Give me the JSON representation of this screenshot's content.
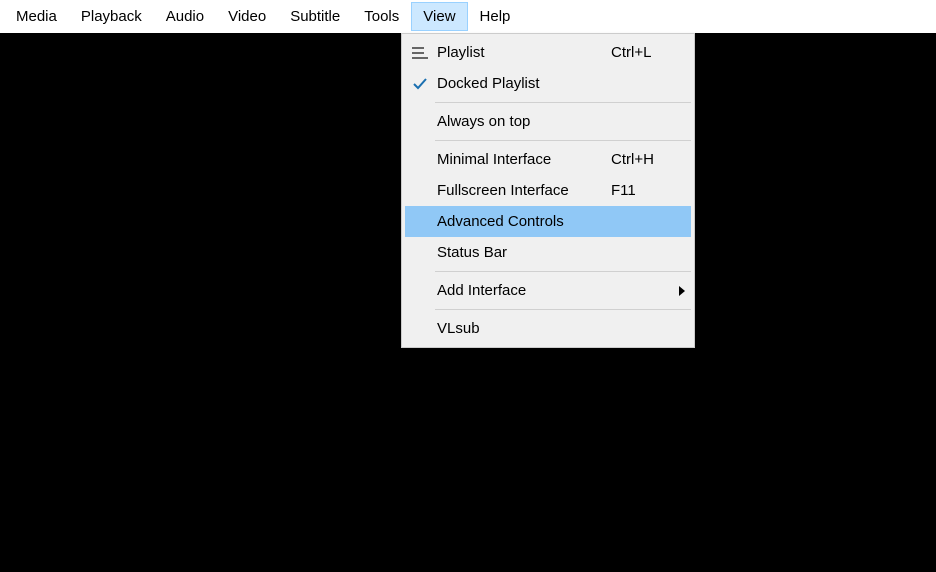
{
  "menubar": {
    "items": [
      {
        "label": "Media"
      },
      {
        "label": "Playback"
      },
      {
        "label": "Audio"
      },
      {
        "label": "Video"
      },
      {
        "label": "Subtitle"
      },
      {
        "label": "Tools"
      },
      {
        "label": "View"
      },
      {
        "label": "Help"
      }
    ],
    "active_index": 6
  },
  "dropdown": {
    "items": [
      {
        "label": "Playlist",
        "shortcut": "Ctrl+L",
        "icon": "playlist"
      },
      {
        "label": "Docked Playlist",
        "shortcut": "",
        "icon": "check"
      },
      {
        "separator": true
      },
      {
        "label": "Always on top",
        "shortcut": "",
        "icon": ""
      },
      {
        "separator": true
      },
      {
        "label": "Minimal Interface",
        "shortcut": "Ctrl+H",
        "icon": ""
      },
      {
        "label": "Fullscreen Interface",
        "shortcut": "F11",
        "icon": ""
      },
      {
        "label": "Advanced Controls",
        "shortcut": "",
        "icon": "",
        "highlight": true
      },
      {
        "label": "Status Bar",
        "shortcut": "",
        "icon": ""
      },
      {
        "separator": true
      },
      {
        "label": "Add Interface",
        "shortcut": "",
        "icon": "",
        "submenu": true
      },
      {
        "separator": true
      },
      {
        "label": "VLsub",
        "shortcut": "",
        "icon": ""
      }
    ]
  }
}
